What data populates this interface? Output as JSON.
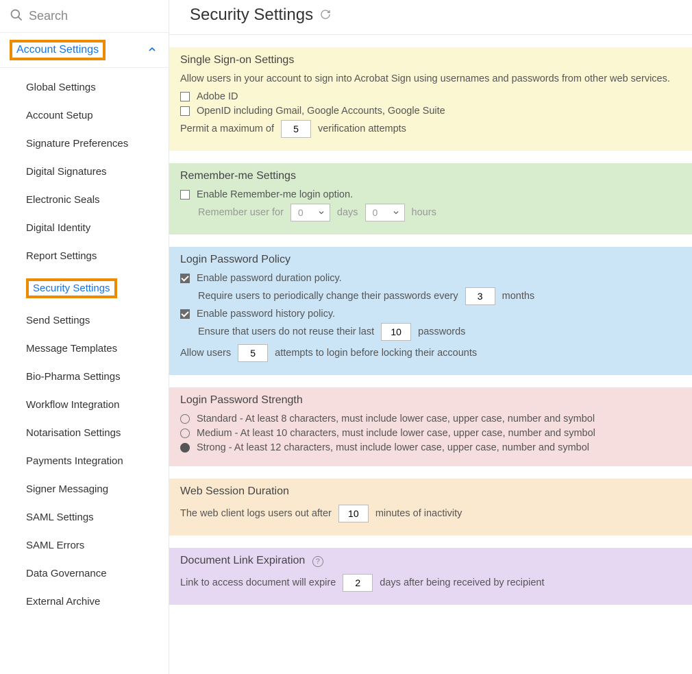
{
  "search": {
    "placeholder": "Search"
  },
  "sidebar": {
    "group_label": "Account Settings",
    "items": [
      {
        "label": "Global Settings"
      },
      {
        "label": "Account Setup"
      },
      {
        "label": "Signature Preferences"
      },
      {
        "label": "Digital Signatures"
      },
      {
        "label": "Electronic Seals"
      },
      {
        "label": "Digital Identity"
      },
      {
        "label": "Report Settings"
      },
      {
        "label": "Security Settings",
        "active": true,
        "highlight": true
      },
      {
        "label": "Send Settings"
      },
      {
        "label": "Message Templates"
      },
      {
        "label": "Bio-Pharma Settings"
      },
      {
        "label": "Workflow Integration"
      },
      {
        "label": "Notarisation Settings"
      },
      {
        "label": "Payments Integration"
      },
      {
        "label": "Signer Messaging"
      },
      {
        "label": "SAML Settings"
      },
      {
        "label": "SAML Errors"
      },
      {
        "label": "Data Governance"
      },
      {
        "label": "External Archive"
      }
    ]
  },
  "page": {
    "title": "Security Settings"
  },
  "sso": {
    "title": "Single Sign-on Settings",
    "desc": "Allow users in your account to sign into Acrobat Sign using usernames and passwords from other web services.",
    "opt_adobe": "Adobe ID",
    "opt_openid": "OpenID including Gmail, Google Accounts, Google Suite",
    "permit_prefix": "Permit a maximum of",
    "permit_value": "5",
    "permit_suffix": "verification attempts"
  },
  "remember": {
    "title": "Remember-me Settings",
    "enable_label": "Enable Remember-me login option.",
    "prefix": "Remember user for",
    "days_value": "0",
    "days_label": "days",
    "hours_value": "0",
    "hours_label": "hours"
  },
  "policy": {
    "title": "Login Password Policy",
    "duration_label": "Enable password duration policy.",
    "duration_prefix": "Require users to periodically change their passwords every",
    "duration_value": "3",
    "duration_suffix": "months",
    "history_label": "Enable password history policy.",
    "history_prefix": "Ensure that users do not reuse their last",
    "history_value": "10",
    "history_suffix": "passwords",
    "attempts_prefix": "Allow users",
    "attempts_value": "5",
    "attempts_suffix": "attempts to login before locking their accounts"
  },
  "strength": {
    "title": "Login Password Strength",
    "opt_standard": "Standard - At least 8 characters, must include lower case, upper case, number and symbol",
    "opt_medium": "Medium - At least 10 characters, must include lower case, upper case, number and symbol",
    "opt_strong": "Strong - At least 12 characters, must include lower case, upper case, number and symbol"
  },
  "session": {
    "title": "Web Session Duration",
    "prefix": "The web client logs users out after",
    "value": "10",
    "suffix": "minutes of inactivity"
  },
  "doclink": {
    "title": "Document Link Expiration",
    "prefix": "Link to access document will expire",
    "value": "2",
    "suffix": "days after being received by recipient"
  }
}
